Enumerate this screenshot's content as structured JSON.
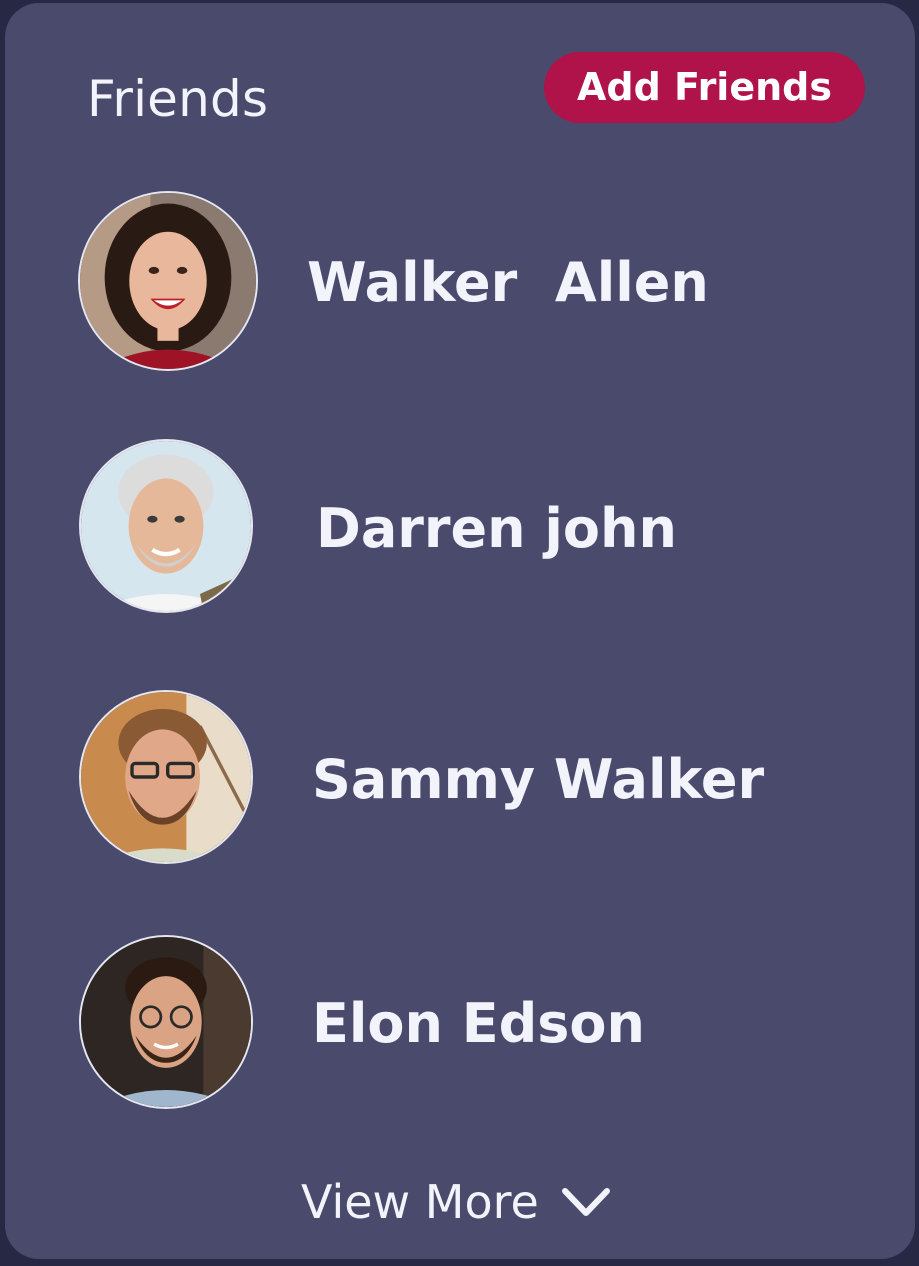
{
  "header": {
    "title": "Friends",
    "add_button_label": "Add Friends"
  },
  "friends": [
    {
      "name": "Walker  Allen"
    },
    {
      "name": "Darren john"
    },
    {
      "name": "Sammy Walker"
    },
    {
      "name": "Elon Edson"
    }
  ],
  "footer": {
    "view_more_label": "View More",
    "icon": "chevron-down-icon"
  },
  "colors": {
    "background": "#262844",
    "card": "#4a4a6d",
    "accent": "#b0124a",
    "text": "#f2f3fb"
  }
}
